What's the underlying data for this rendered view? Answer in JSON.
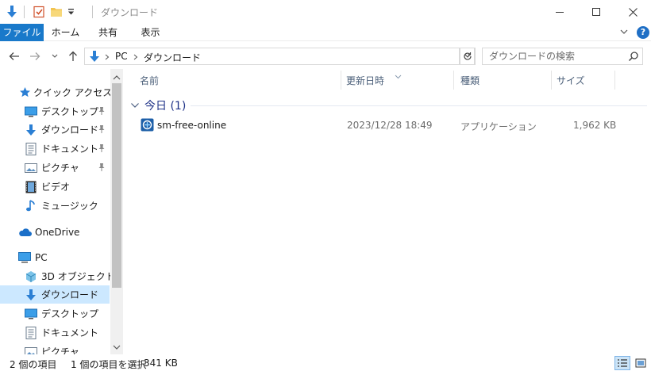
{
  "window": {
    "title": "ダウンロード",
    "controls": [
      "minimize",
      "maximize",
      "close"
    ]
  },
  "ribbon": {
    "tabs": [
      {
        "label": "ファイル",
        "active": true
      },
      {
        "label": "ホーム"
      },
      {
        "label": "共有"
      },
      {
        "label": "表示"
      }
    ],
    "help_label": "?"
  },
  "address": {
    "segments": [
      "PC",
      "ダウンロード"
    ]
  },
  "search": {
    "placeholder": "ダウンロードの検索"
  },
  "navpane": {
    "quick_access": "クイック アクセス",
    "quick_items": [
      {
        "label": "デスクトップ",
        "icon": "desktop-icon",
        "pinned": true
      },
      {
        "label": "ダウンロード",
        "icon": "download-icon",
        "pinned": true
      },
      {
        "label": "ドキュメント",
        "icon": "document-icon",
        "pinned": true
      },
      {
        "label": "ピクチャ",
        "icon": "picture-icon",
        "pinned": true
      },
      {
        "label": "ビデオ",
        "icon": "video-icon"
      },
      {
        "label": "ミュージック",
        "icon": "music-icon"
      }
    ],
    "onedrive": "OneDrive",
    "pc": "PC",
    "pc_items": [
      {
        "label": "3D オブジェクト",
        "icon": "3d-objects-icon"
      },
      {
        "label": "ダウンロード",
        "icon": "download-icon",
        "selected": true
      },
      {
        "label": "デスクトップ",
        "icon": "desktop-icon"
      },
      {
        "label": "ドキュメント",
        "icon": "document-icon"
      },
      {
        "label": "ピクチャ",
        "icon": "picture-icon"
      }
    ]
  },
  "columns": {
    "name": "名前",
    "date": "更新日時",
    "type": "種類",
    "size": "サイズ"
  },
  "group": {
    "label": "今日 (1)"
  },
  "files": [
    {
      "name": "sm-free-online",
      "date": "2023/12/28 18:49",
      "type": "アプリケーション",
      "size": "1,962 KB",
      "icon": "application-icon"
    }
  ],
  "status": {
    "item_count": "2 個の項目",
    "selection": "1 個の項目を選択",
    "selection_size": "341 KB"
  },
  "colors": {
    "accent": "#1979ca",
    "selected_bg": "#cce8ff",
    "group_text": "#1e3287"
  }
}
